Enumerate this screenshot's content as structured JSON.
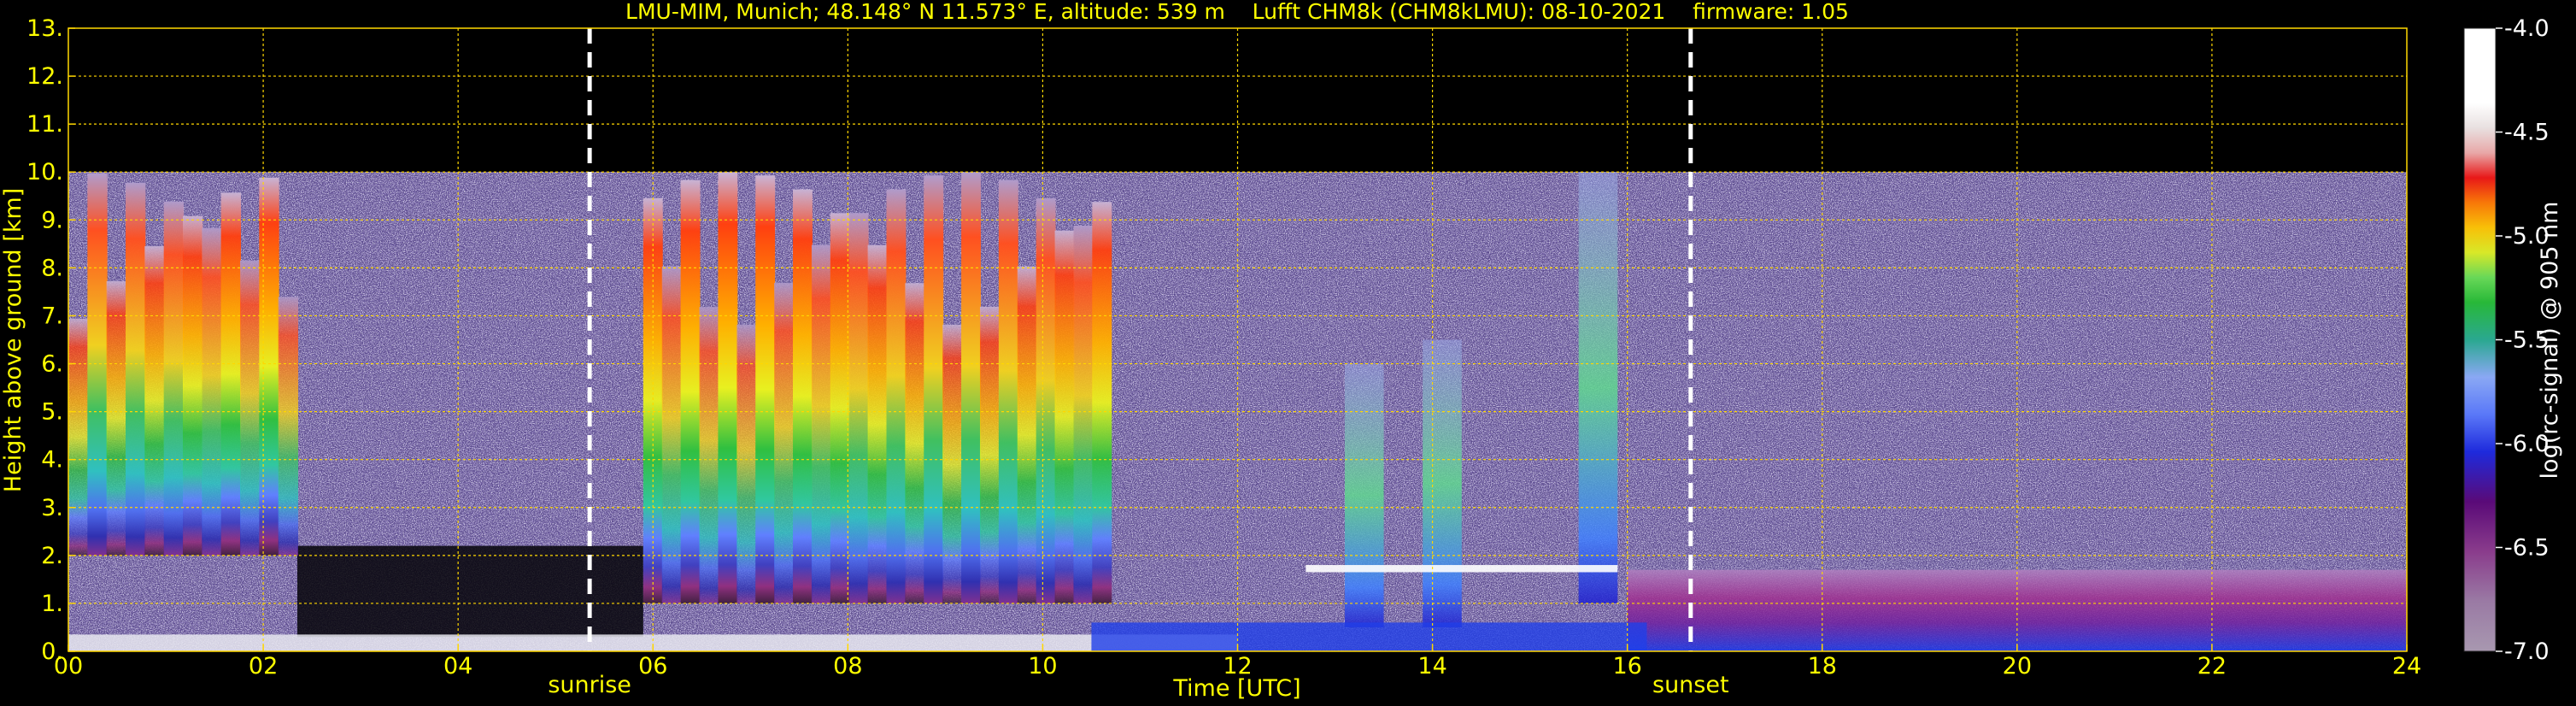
{
  "chart_data": {
    "type": "heatmap",
    "title": "LMU-MIM, Munich; 48.148° N 11.573° E, altitude: 539 m    Lufft CHM8k (CHM8kLMU): 08-10-2021    firmware: 1.05",
    "xlabel": "Time [UTC]",
    "ylabel": "Height above ground [km]",
    "x_ticks": [
      "00",
      "02",
      "04",
      "06",
      "08",
      "10",
      "12",
      "14",
      "16",
      "18",
      "20",
      "22",
      "24"
    ],
    "y_ticks": [
      "0.",
      "1.",
      "2.",
      "3.",
      "4.",
      "5.",
      "6.",
      "7.",
      "8.",
      "9.",
      "10.",
      "11.",
      "12.",
      "13."
    ],
    "xlim": [
      0,
      24
    ],
    "ylim": [
      0,
      13
    ],
    "grid": true,
    "markers": [
      {
        "label": "sunrise",
        "time_utc": 5.35
      },
      {
        "label": "sunset",
        "time_utc": 16.65
      }
    ],
    "colorbar": {
      "label": "log(rc-signal) @ 905 nm",
      "ticks": [
        "-4.0",
        "-4.5",
        "-5.0",
        "-5.5",
        "-6.0",
        "-6.5",
        "-7.0"
      ],
      "range": [
        -7.0,
        -4.0
      ]
    },
    "data_max_height_km": 10,
    "features": [
      {
        "name": "high cloud",
        "time_start": 0.0,
        "time_end": 2.35,
        "base_km": 2.0,
        "top_km": 10.0
      },
      {
        "name": "high cloud",
        "time_start": 5.9,
        "time_end": 10.7,
        "base_km": 1.0,
        "top_km": 10.0
      },
      {
        "name": "cloud tower",
        "time_start": 13.1,
        "time_end": 13.5,
        "base_km": 0.5,
        "top_km": 6.0
      },
      {
        "name": "cloud tower",
        "time_start": 13.9,
        "time_end": 14.3,
        "base_km": 0.5,
        "top_km": 6.5
      },
      {
        "name": "cloud tower",
        "time_start": 15.5,
        "time_end": 15.9,
        "base_km": 1.0,
        "top_km": 10.0
      },
      {
        "name": "cloud layer",
        "time_start": 12.7,
        "time_end": 15.9,
        "base_km": 1.65,
        "top_km": 1.8
      },
      {
        "name": "boundary layer",
        "time_start": 16.0,
        "time_end": 24.0,
        "base_km": 0.0,
        "top_km": 1.7
      }
    ]
  }
}
